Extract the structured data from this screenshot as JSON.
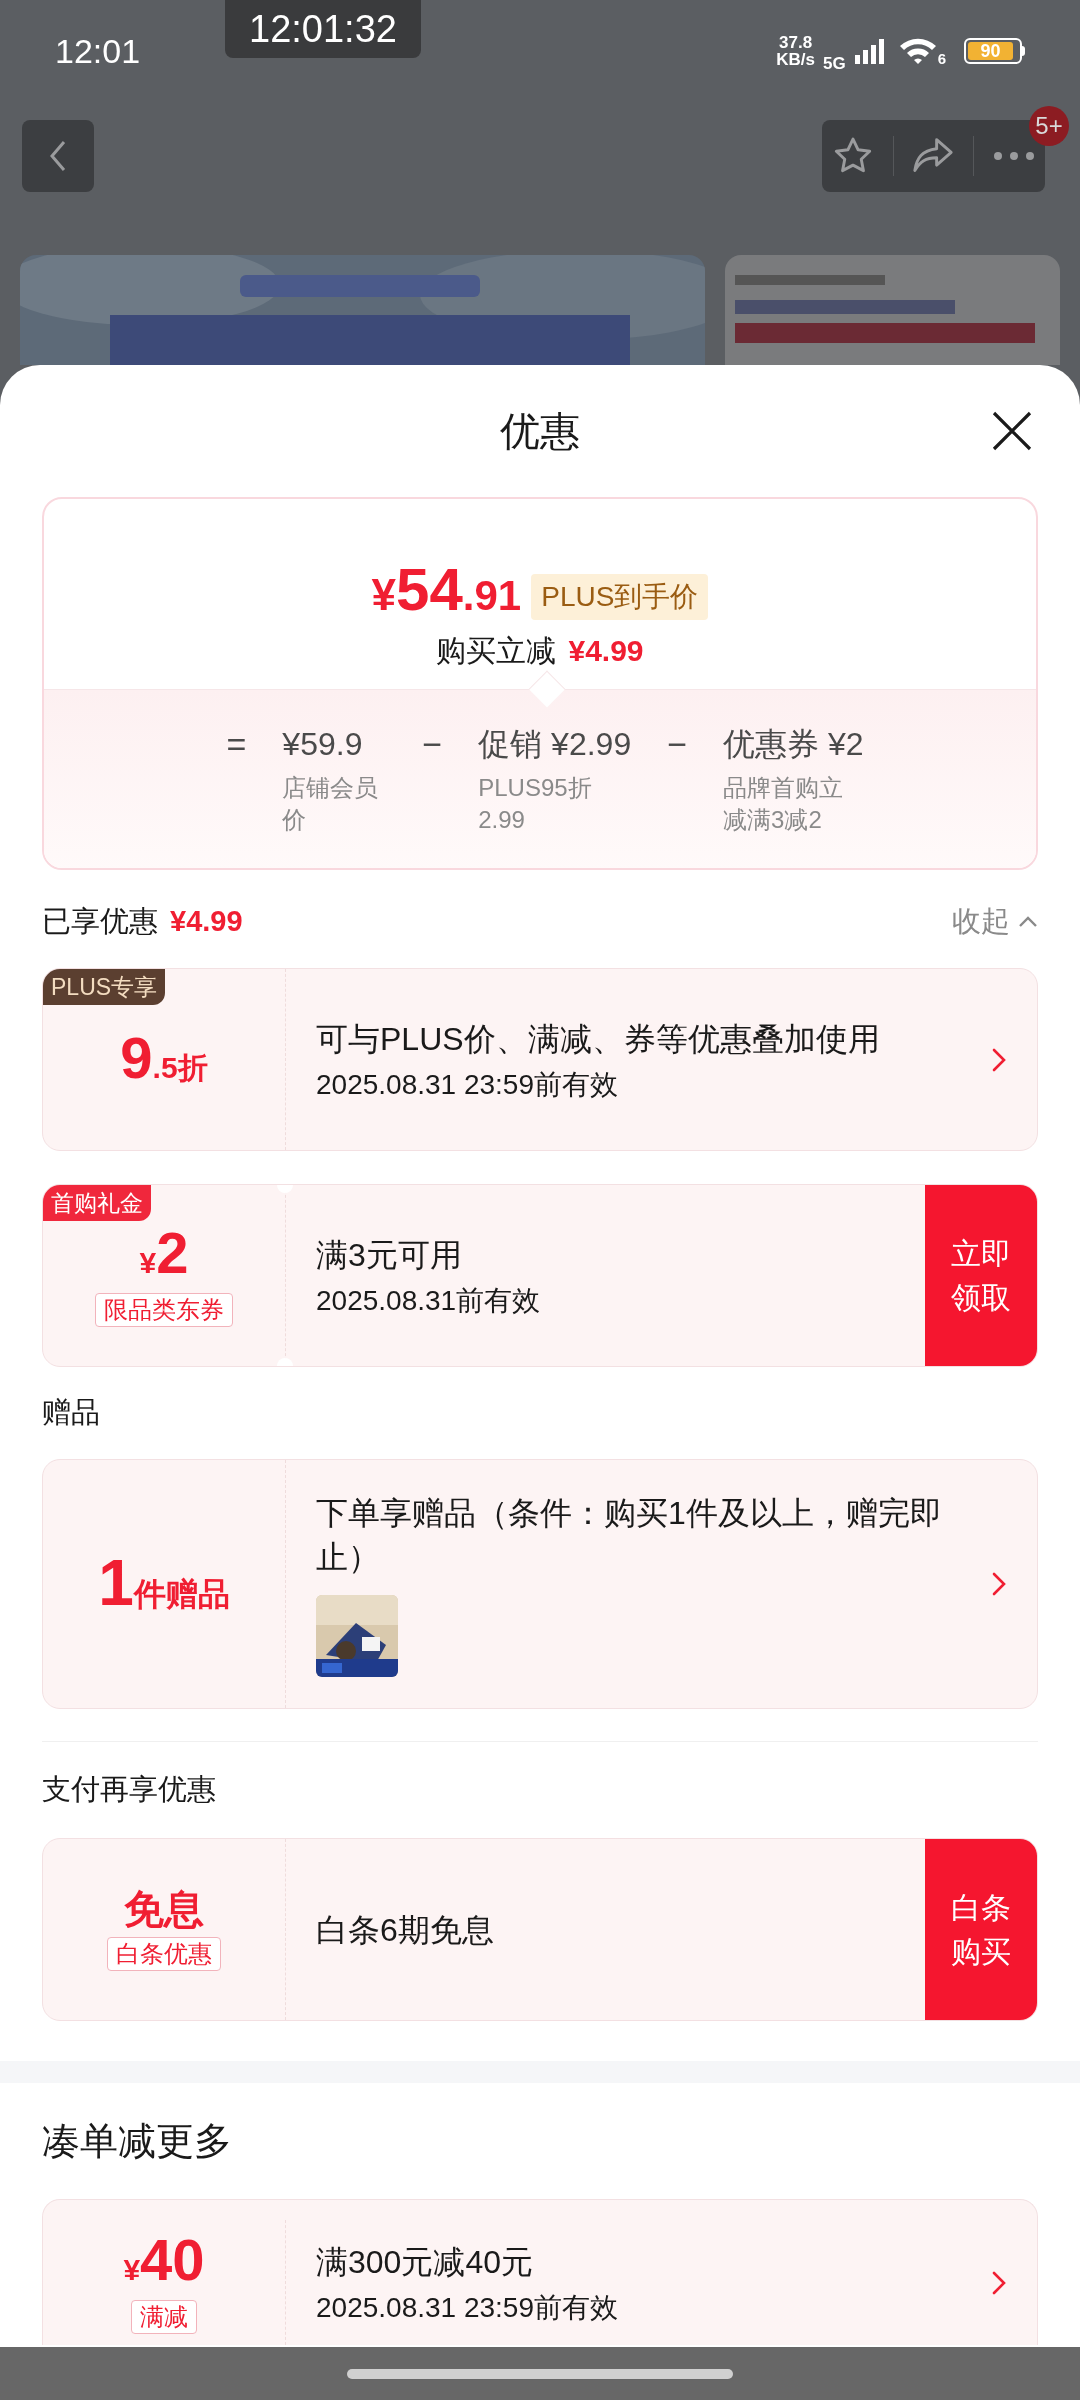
{
  "status_bar": {
    "time": "12:01",
    "overlay_clock": "12:01:32",
    "speed_value": "37.8",
    "speed_unit": "KB/s",
    "network": "5G",
    "wifi_band": "6",
    "battery": "90"
  },
  "nav": {
    "badge": "5+"
  },
  "sheet": {
    "title": "优惠"
  },
  "price_card": {
    "currency": "¥",
    "price_int": "54",
    "price_dec": ".91",
    "tag": "PLUS到手价",
    "subtitle": "购买立减",
    "subtitle_amount": "¥4.99",
    "breakdown": [
      {
        "op": "=",
        "amount": "¥59.9",
        "note": "店铺会员价"
      },
      {
        "op": "−",
        "amount": "促销 ¥2.99",
        "note": "PLUS95折2.99"
      },
      {
        "op": "−",
        "amount": "优惠券 ¥2",
        "note": "品牌首购立减满3减2"
      }
    ]
  },
  "applied": {
    "label": "已享优惠",
    "amount": "¥4.99",
    "toggle": "收起",
    "expanded": true,
    "coupons": [
      {
        "kind": "discount",
        "corner_tag": "PLUS专享",
        "color": "#5b3f30",
        "big": "9",
        "suffix": ".5折",
        "title": "可与PLUS价、满减、券等优惠叠加使用",
        "validity": "2025.08.31 23:59前有效"
      },
      {
        "kind": "coupon",
        "corner_tag": "首购礼金",
        "color": "#f0273c",
        "prefix": "¥",
        "big": "2",
        "sub_tag": "限品类东券",
        "title": "满3元可用",
        "validity": "2025.08.31前有效",
        "action": "立即领取"
      }
    ]
  },
  "gifts": {
    "title": "赠品",
    "coupons": [
      {
        "kind": "gift",
        "big": "1",
        "suffix": "件赠品",
        "title": "下单享赠品（条件：购买1件及以上，赠完即止）"
      }
    ]
  },
  "payment": {
    "title": "支付再享优惠",
    "coupons": [
      {
        "kind": "pay",
        "big": "免息",
        "sub_tag": "白条优惠",
        "title": "白条6期免息",
        "action": "白条购买"
      }
    ]
  },
  "bundle": {
    "title": "凑单减更多",
    "coupons": [
      {
        "kind": "reduction",
        "prefix": "¥",
        "big": "40",
        "sub_tag": "满减",
        "title": "满300元减40元",
        "validity": "2025.08.31 23:59前有效"
      }
    ]
  }
}
